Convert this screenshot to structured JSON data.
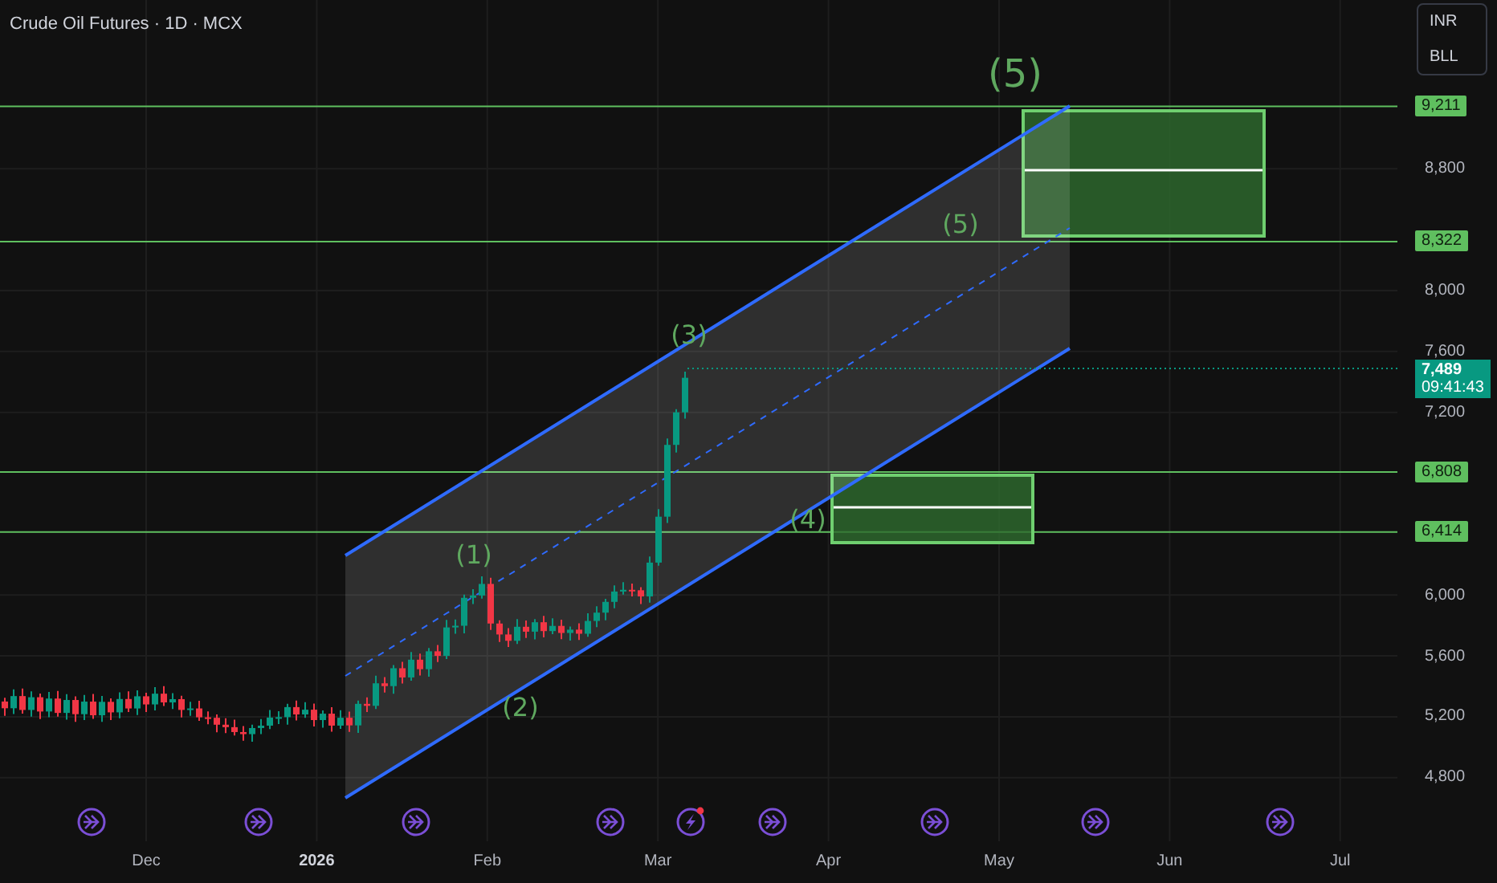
{
  "header": {
    "title": "Crude Oil Futures · 1D · MCX"
  },
  "toggles": [
    {
      "label": "INR"
    },
    {
      "label": "BLL"
    }
  ],
  "price_axis": {
    "ticks": [
      "8,800",
      "8,000",
      "7,600",
      "7,200",
      "6,000",
      "5,600",
      "5,200",
      "4,800"
    ]
  },
  "levels": [
    {
      "value": "9,211"
    },
    {
      "value": "8,322"
    },
    {
      "value": "6,808"
    },
    {
      "value": "6,414"
    }
  ],
  "last_price": {
    "value": "7,489",
    "countdown": "09:41:43"
  },
  "wave_labels": [
    {
      "text": "(1)"
    },
    {
      "text": "(2)"
    },
    {
      "text": "(3)"
    },
    {
      "text": "(4)"
    },
    {
      "text": "(5)"
    },
    {
      "text": "(5)"
    }
  ],
  "time_axis": {
    "labels": [
      {
        "text": "Dec",
        "year": false
      },
      {
        "text": "2026",
        "year": true
      },
      {
        "text": "Feb",
        "year": false
      },
      {
        "text": "Mar",
        "year": false
      },
      {
        "text": "Apr",
        "year": false
      },
      {
        "text": "May",
        "year": false
      },
      {
        "text": "Jun",
        "year": false
      },
      {
        "text": "Jul",
        "year": false
      }
    ]
  },
  "events": [
    {
      "kind": "arrow"
    },
    {
      "kind": "arrow"
    },
    {
      "kind": "arrow"
    },
    {
      "kind": "arrow"
    },
    {
      "kind": "bolt"
    },
    {
      "kind": "arrow"
    },
    {
      "kind": "arrow"
    },
    {
      "kind": "arrow"
    },
    {
      "kind": "arrow"
    }
  ]
}
